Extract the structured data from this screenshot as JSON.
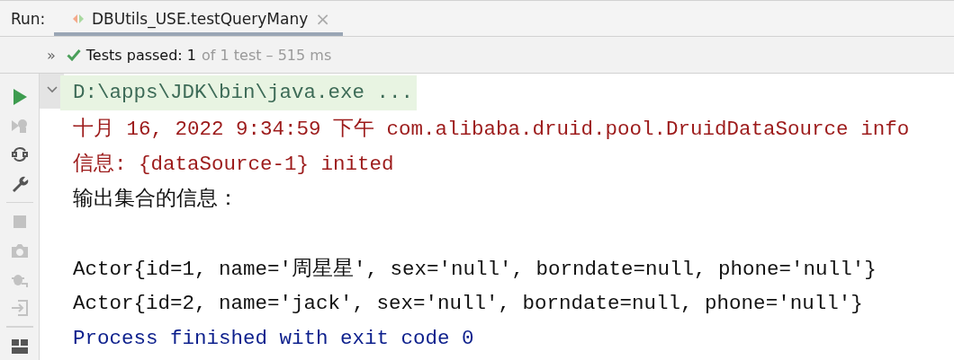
{
  "run_bar": {
    "label": "Run:",
    "tabs": [
      {
        "title": "DBUtils_USE.testQueryMany",
        "close": "×",
        "selected": true
      }
    ]
  },
  "status": {
    "expand": "»",
    "summary": "Tests passed: 1",
    "detail": "of 1 test – 515 ms"
  },
  "toolbar": [
    {
      "kind": "run",
      "disabled": false
    },
    {
      "kind": "rerun-failed",
      "disabled": true
    },
    {
      "kind": "toggle-auto",
      "disabled": false
    },
    {
      "kind": "settings",
      "disabled": false
    },
    {
      "kind": "divider"
    },
    {
      "kind": "stop",
      "disabled": true
    },
    {
      "kind": "camera",
      "disabled": true
    },
    {
      "kind": "debug-export",
      "disabled": true
    },
    {
      "kind": "import",
      "disabled": true
    },
    {
      "kind": "divider"
    },
    {
      "kind": "layout",
      "disabled": false
    }
  ],
  "console": {
    "expanded": true,
    "lines": [
      {
        "kind": "command",
        "text": "D:\\apps\\JDK\\bin\\java.exe ..."
      },
      {
        "kind": "stderr",
        "text": "十月 16, 2022 9:34:59 下午 com.alibaba.druid.pool.DruidDataSource info"
      },
      {
        "kind": "stderr",
        "text": "信息: {dataSource-1} inited"
      },
      {
        "kind": "stdout",
        "text": "输出集合的信息："
      },
      {
        "kind": "blank"
      },
      {
        "kind": "stdout",
        "text": "Actor{id=1, name='周星星', sex='null', borndate=null, phone='null'}"
      },
      {
        "kind": "stdout",
        "text": "Actor{id=2, name='jack', sex='null', borndate=null, phone='null'}"
      },
      {
        "kind": "system",
        "text": "Process finished with exit code 0"
      }
    ]
  }
}
